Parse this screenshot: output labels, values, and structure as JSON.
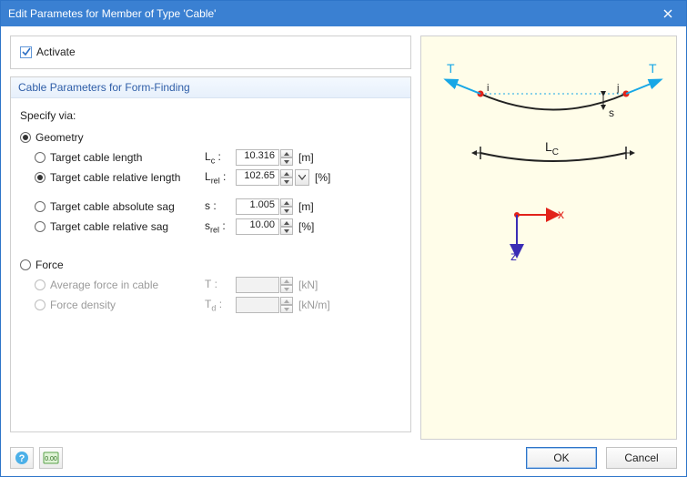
{
  "title": "Edit Parametes for Member of Type 'Cable'",
  "activate": {
    "label": "Activate",
    "checked": true
  },
  "section_header": "Cable Parameters for Form-Finding",
  "specify_via": "Specify via:",
  "geometry": {
    "label": "Geometry",
    "options": {
      "target_length": {
        "label": "Target cable length",
        "sym": "L",
        "sub": "c",
        "value": "10.316",
        "unit": "[m]",
        "selected": false
      },
      "target_rel_len": {
        "label": "Target cable relative length",
        "sym": "L",
        "sub": "rel",
        "value": "102.65",
        "unit": "[%]",
        "selected": true,
        "extra": true
      },
      "target_abs_sag": {
        "label": "Target cable absolute sag",
        "sym": "s",
        "sub": "",
        "value": "1.005",
        "unit": "[m]",
        "selected": false
      },
      "target_rel_sag": {
        "label": "Target cable relative sag",
        "sym": "s",
        "sub": "rel",
        "value": "10.00",
        "unit": "[%]",
        "selected": false
      }
    }
  },
  "force": {
    "label": "Force",
    "options": {
      "avg_force": {
        "label": "Average force in cable",
        "sym": "T",
        "sub": "",
        "value": "",
        "unit": "[kN]"
      },
      "force_density": {
        "label": "Force density",
        "sym": "T",
        "sub": "d",
        "value": "",
        "unit": "[kN/m]"
      }
    }
  },
  "diagram": {
    "T": "T",
    "s": "s",
    "Lc": "L",
    "Lc_sub": "C",
    "x": "x",
    "z": "z",
    "i": "i",
    "j": "j"
  },
  "buttons": {
    "ok": "OK",
    "cancel": "Cancel"
  }
}
